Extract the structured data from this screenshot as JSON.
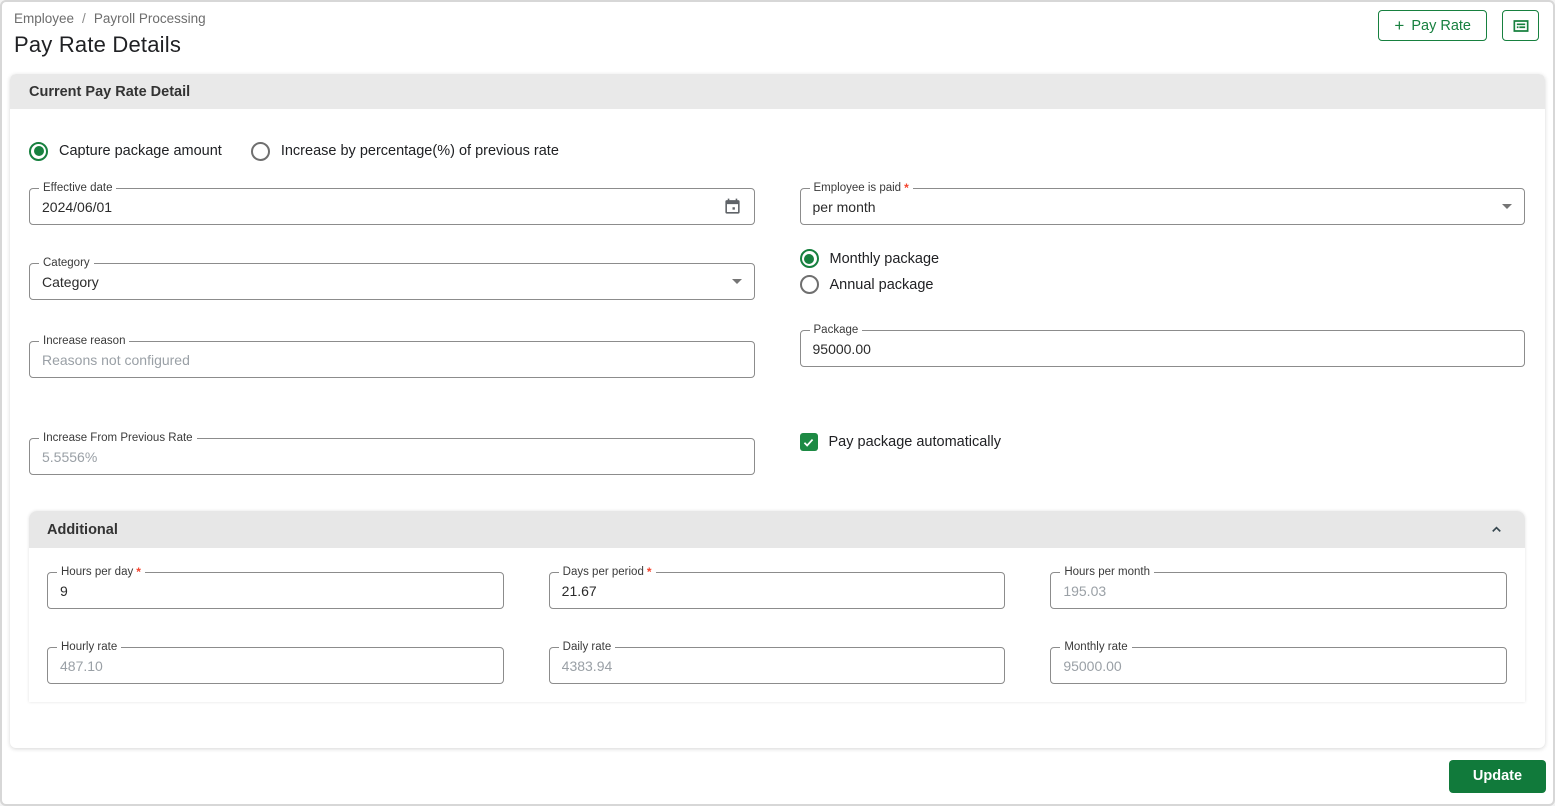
{
  "required_marker": "*",
  "page": {
    "breadcrumb": [
      "Employee",
      "Payroll Processing"
    ],
    "breadcrumb_separator": "/",
    "title": "Pay Rate Details",
    "actions": {
      "add_icon": "+",
      "add_pay_rate_label": "Pay Rate"
    }
  },
  "colors": {
    "accent_green": "#17803f",
    "button_green": "#117a3b",
    "header_bar_gray": "#e9e9e9",
    "required_red": "#f4442e",
    "disabled_text_gray": "#9aa0a6"
  },
  "current_section": {
    "title": "Current Pay Rate Detail",
    "mode_options": [
      {
        "label": "Capture package amount",
        "selected": true
      },
      {
        "label": "Increase by percentage(%) of previous rate",
        "selected": false
      }
    ],
    "fields": {
      "effective_date": {
        "label": "Effective date",
        "value": "2024/06/01"
      },
      "employee_is_paid": {
        "label": "Employee is paid",
        "value": "per month",
        "required": true
      },
      "category": {
        "label": "Category",
        "value": "Category"
      },
      "increase_reason": {
        "label": "Increase reason",
        "placeholder": "Reasons not configured"
      },
      "package": {
        "label": "Package",
        "value": "95000.00"
      },
      "increase_from_previous_rate": {
        "label": "Increase From Previous Rate",
        "value": "5.5556%",
        "disabled": true
      }
    },
    "package_type_options": [
      {
        "label": "Monthly package",
        "selected": true
      },
      {
        "label": "Annual package",
        "selected": false
      }
    ],
    "pay_package_automatically": {
      "label": "Pay package automatically",
      "checked": true
    }
  },
  "additional_section": {
    "title": "Additional",
    "fields": [
      {
        "label": "Hours per day",
        "value": "9",
        "required": true
      },
      {
        "label": "Days per period",
        "value": "21.67",
        "required": true
      },
      {
        "label": "Hours per month",
        "value": "195.03",
        "disabled": true
      },
      {
        "label": "Hourly rate",
        "value": "487.10",
        "disabled": true
      },
      {
        "label": "Daily rate",
        "value": "4383.94",
        "disabled": true
      },
      {
        "label": "Monthly rate",
        "value": "95000.00",
        "disabled": true
      }
    ]
  },
  "footer": {
    "update_label": "Update"
  }
}
